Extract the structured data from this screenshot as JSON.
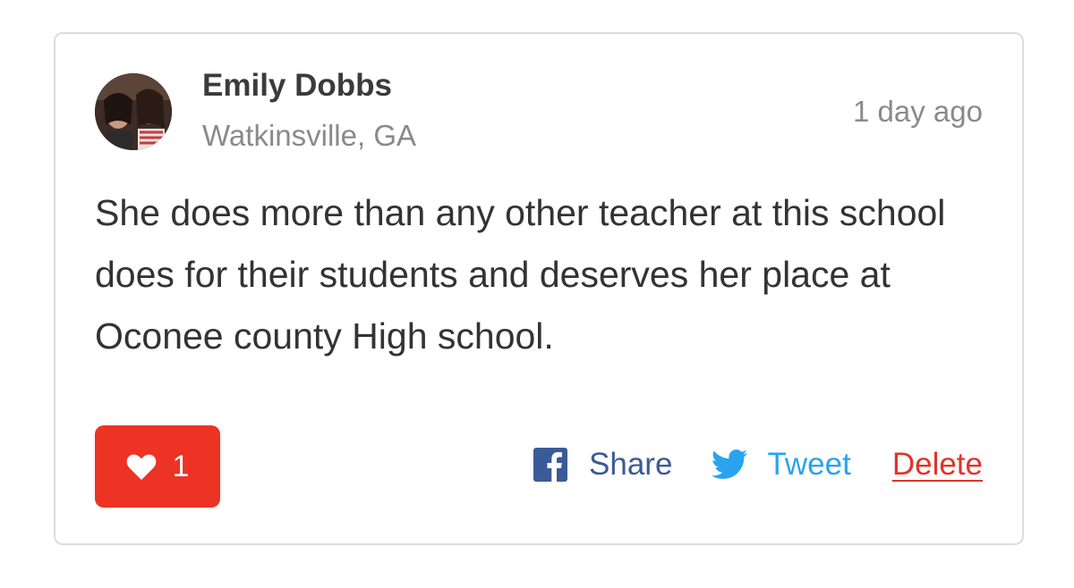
{
  "post": {
    "author_name": "Emily Dobbs",
    "author_location": "Watkinsville, GA",
    "timestamp": "1 day ago",
    "body": "She does more than any other teacher at this school does for their students and deserves her place at Oconee county High school."
  },
  "like": {
    "count": "1",
    "icon": "heart-icon"
  },
  "actions": {
    "share_label": "Share",
    "share_icon": "facebook-icon",
    "tweet_label": "Tweet",
    "tweet_icon": "twitter-bird-icon",
    "delete_label": "Delete"
  },
  "colors": {
    "like_button": "#ec3324",
    "share": "#3b5a98",
    "tweet": "#2aa3ef",
    "delete": "#e0342a",
    "border": "#dcdcdc"
  }
}
